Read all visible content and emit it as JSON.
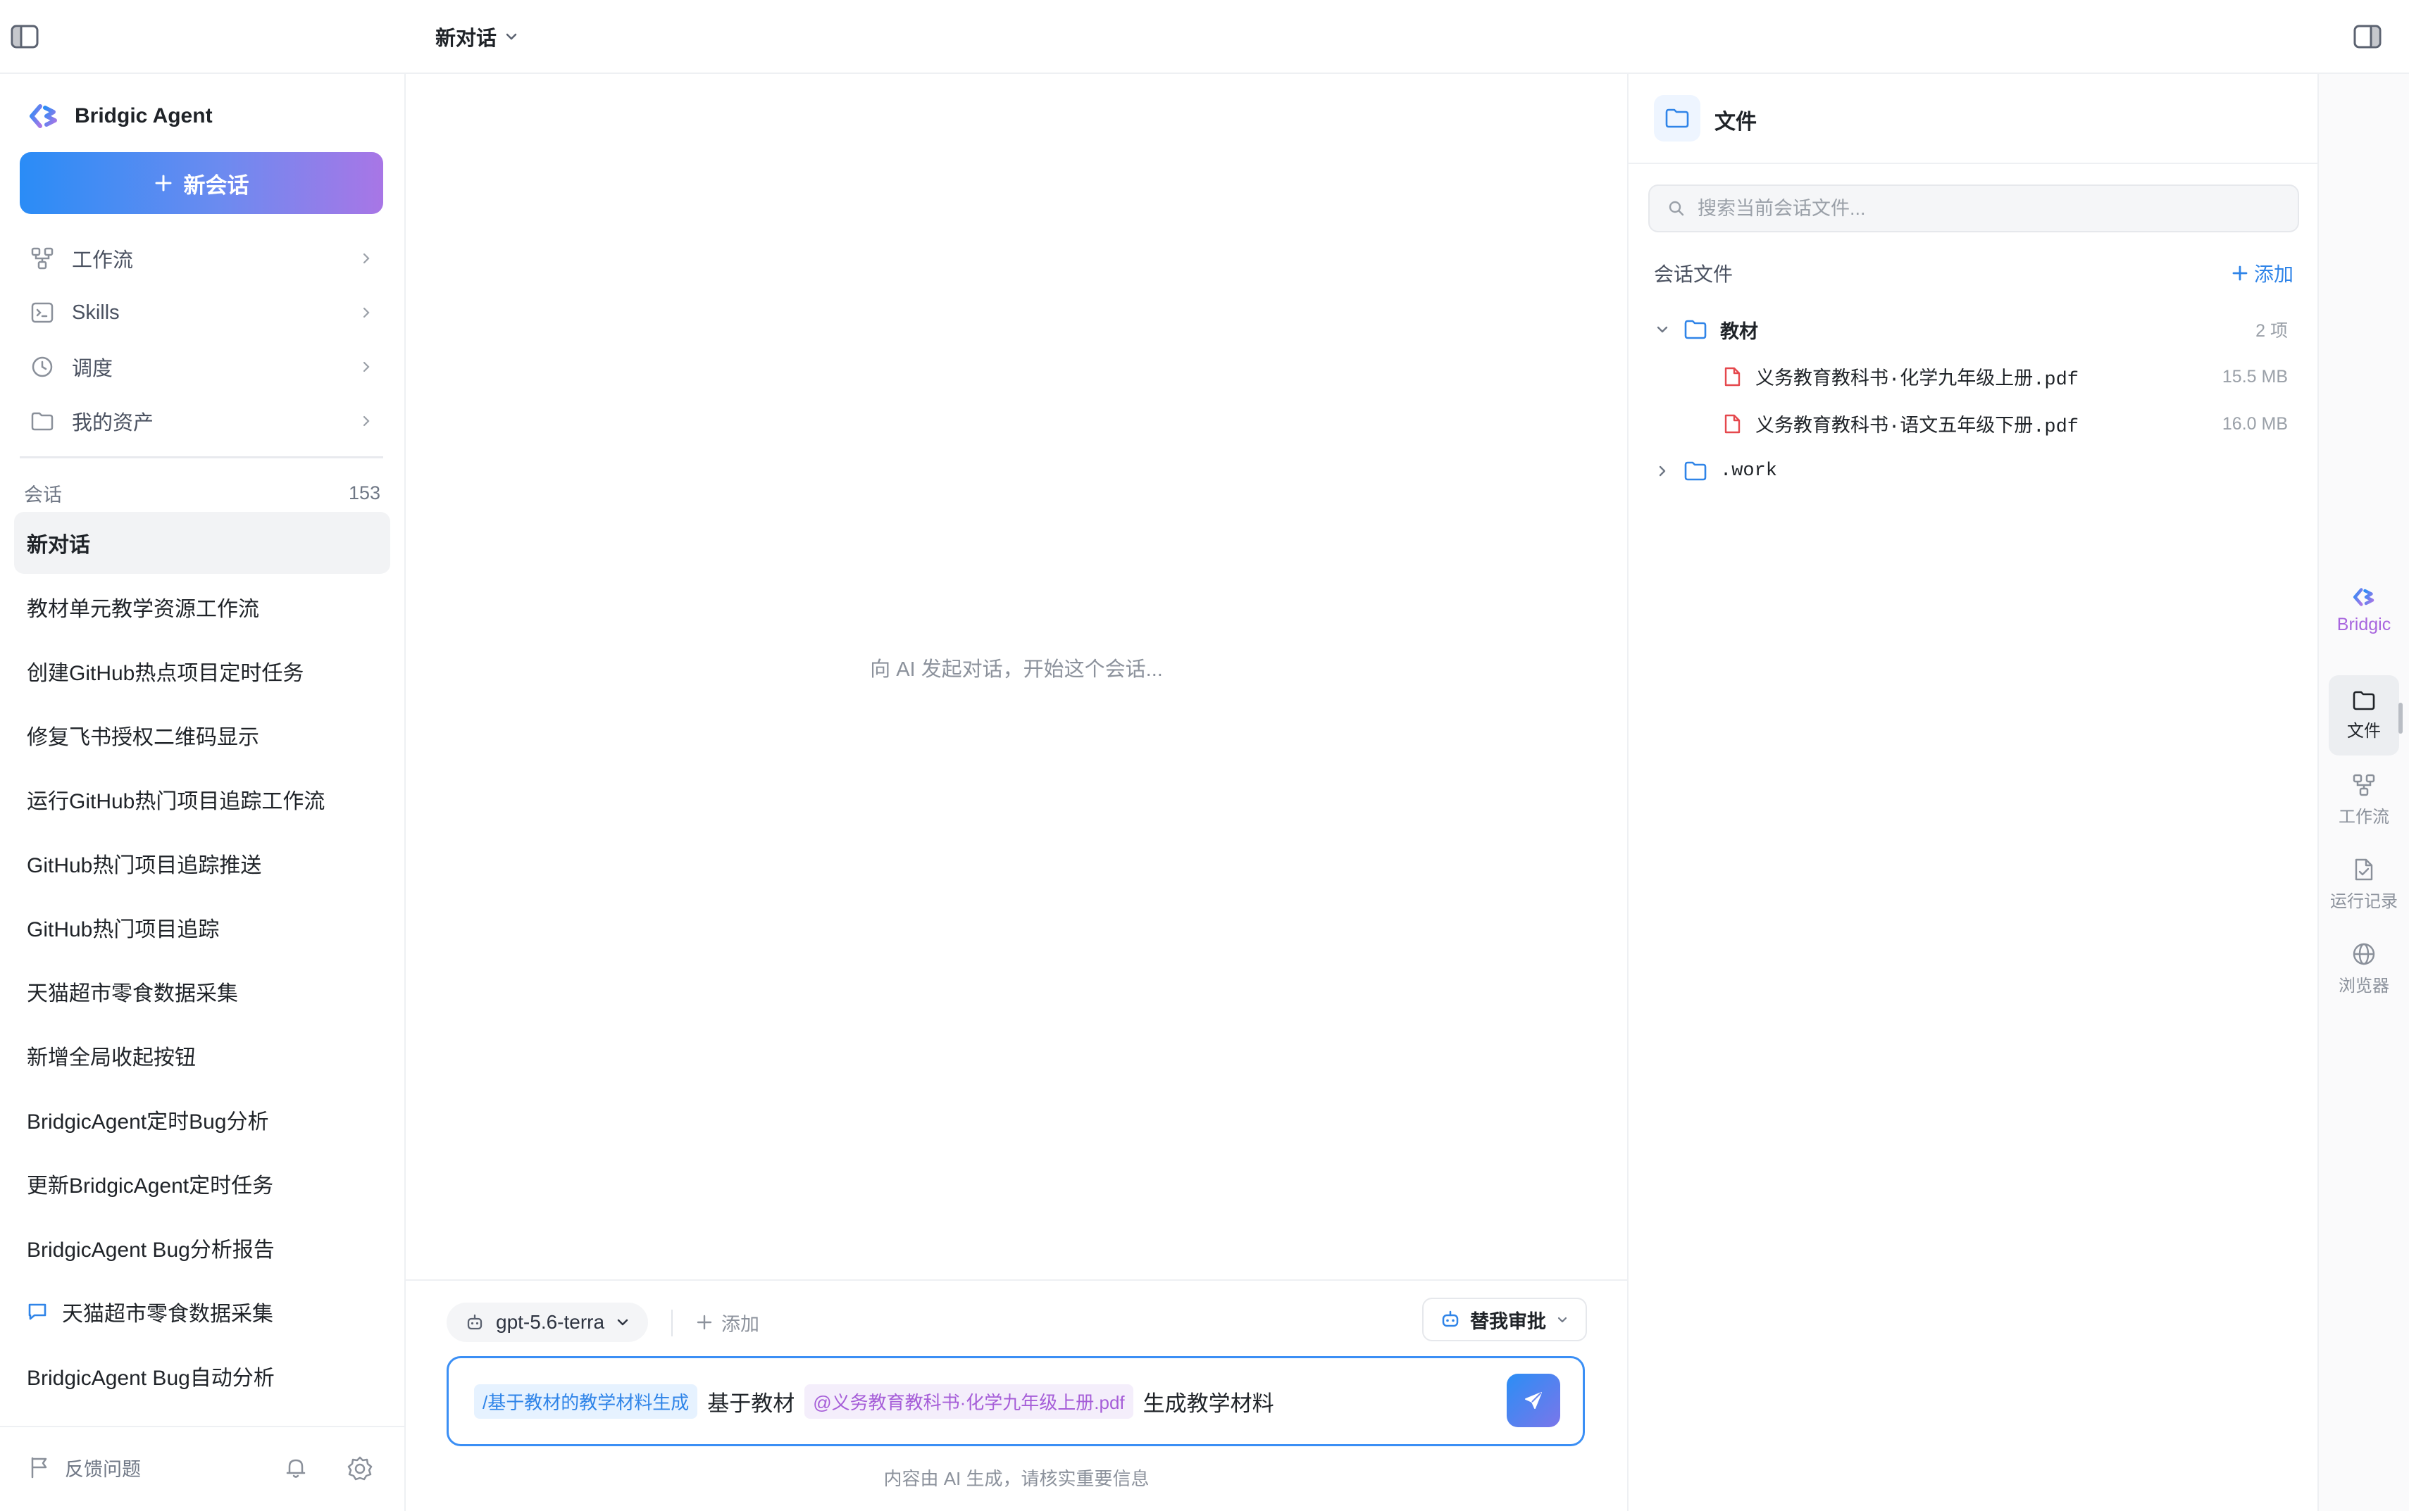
{
  "header": {
    "title": "新对话"
  },
  "sidebar": {
    "brand": "Bridgic Agent",
    "new_chat_label": "新会话",
    "nav": [
      {
        "label": "工作流",
        "icon": "workflow-icon"
      },
      {
        "label": "Skills",
        "icon": "terminal-icon"
      },
      {
        "label": "调度",
        "icon": "clock-icon"
      },
      {
        "label": "我的资产",
        "icon": "folder-icon"
      }
    ],
    "conversations_label": "会话",
    "conversations_count": "153",
    "conversations": [
      {
        "title": "新对话",
        "active": true
      },
      {
        "title": "教材单元教学资源工作流"
      },
      {
        "title": "创建GitHub热点项目定时任务"
      },
      {
        "title": "修复飞书授权二维码显示"
      },
      {
        "title": "运行GitHub热门项目追踪工作流"
      },
      {
        "title": "GitHub热门项目追踪推送"
      },
      {
        "title": "GitHub热门项目追踪"
      },
      {
        "title": "天猫超市零食数据采集"
      },
      {
        "title": "新增全局收起按钮"
      },
      {
        "title": "BridgicAgent定时Bug分析"
      },
      {
        "title": "更新BridgicAgent定时任务"
      },
      {
        "title": "BridgicAgent Bug分析报告"
      },
      {
        "title": "天猫超市零食数据采集",
        "icon": "chat-bubble-icon"
      },
      {
        "title": "BridgicAgent Bug自动分析"
      }
    ],
    "feedback_label": "反馈问题"
  },
  "main": {
    "empty_hint": "向 AI 发起对话，开始这个会话...",
    "model": "gpt-5.6-terra",
    "add_label": "添加",
    "approve_label": "替我审批",
    "input": {
      "skill_chip": "/基于教材的教学材料生成",
      "text1": "基于教材",
      "file_chip": "@义务教育教科书·化学九年级上册.pdf",
      "text2": "生成教学材料"
    },
    "disclaimer": "内容由 AI 生成，请核实重要信息"
  },
  "files_panel": {
    "title": "文件",
    "search_placeholder": "搜索当前会话文件...",
    "section_label": "会话文件",
    "add_label": "添加",
    "tree": {
      "folder1": {
        "name": "教材",
        "count": "2 项"
      },
      "files": [
        {
          "name": "义务教育教科书·化学九年级上册.pdf",
          "size": "15.5 MB"
        },
        {
          "name": "义务教育教科书·语文五年级下册.pdf",
          "size": "16.0 MB"
        }
      ],
      "folder2": {
        "name": ".work"
      }
    }
  },
  "rail": {
    "brand": "Bridgic",
    "items": [
      {
        "label": "文件",
        "icon": "folder-icon",
        "active": true
      },
      {
        "label": "工作流",
        "icon": "workflow-icon"
      },
      {
        "label": "运行记录",
        "icon": "run-log-icon"
      },
      {
        "label": "浏览器",
        "icon": "globe-icon"
      }
    ]
  },
  "colors": {
    "accent_blue": "#2f84e8",
    "accent_purple": "#a866de",
    "file_red": "#e5484d"
  }
}
